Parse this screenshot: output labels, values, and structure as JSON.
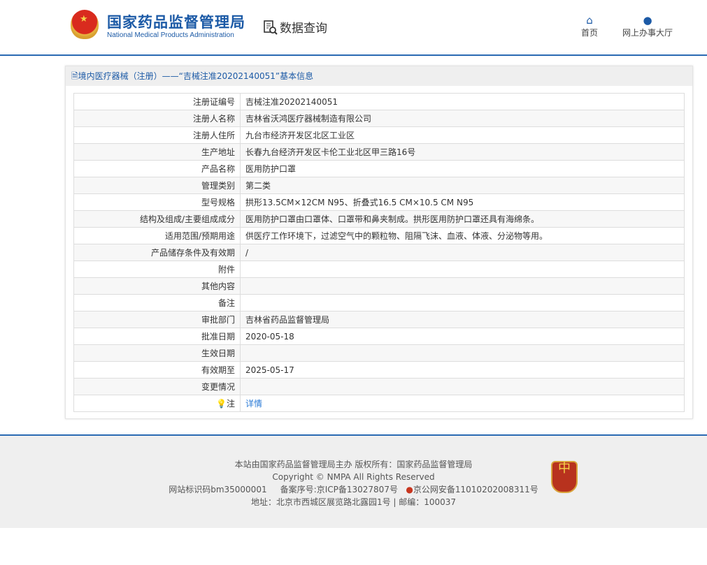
{
  "header": {
    "logo_cn": "国家药品监督管理局",
    "logo_en": "National Medical Products Administration",
    "query_label": "数据查询",
    "nav": [
      {
        "label": "首页",
        "icon": "home-icon"
      },
      {
        "label": "网上办事大厅",
        "icon": "user-icon"
      }
    ]
  },
  "panel": {
    "title": "境内医疗器械（注册）——“吉械注准20202140051”基本信息",
    "rows": [
      {
        "label": "注册证编号",
        "value": "吉械注准20202140051"
      },
      {
        "label": "注册人名称",
        "value": "吉林省沃鸿医疗器械制造有限公司"
      },
      {
        "label": "注册人住所",
        "value": "九台市经济开发区北区工业区"
      },
      {
        "label": "生产地址",
        "value": "长春九台经济开发区卡伦工业北区甲三路16号"
      },
      {
        "label": "产品名称",
        "value": "医用防护口罩"
      },
      {
        "label": "管理类别",
        "value": "第二类"
      },
      {
        "label": "型号规格",
        "value": "拱形13.5CM×12CM N95、折叠式16.5 CM×10.5 CM N95"
      },
      {
        "label": "结构及组成/主要组成成分",
        "value": "医用防护口罩由口罩体、口罩带和鼻夹制成。拱形医用防护口罩还具有海绵条。"
      },
      {
        "label": "适用范围/预期用途",
        "value": "供医疗工作环境下，过滤空气中的颗粒物、阻隔飞沫、血液、体液、分泌物等用。"
      },
      {
        "label": "产品储存条件及有效期",
        "value": "/"
      },
      {
        "label": "附件",
        "value": ""
      },
      {
        "label": "其他内容",
        "value": ""
      },
      {
        "label": "备注",
        "value": ""
      },
      {
        "label": "审批部门",
        "value": "吉林省药品监督管理局"
      },
      {
        "label": "批准日期",
        "value": "2020-05-18"
      },
      {
        "label": "生效日期",
        "value": ""
      },
      {
        "label": "有效期至",
        "value": "2025-05-17"
      },
      {
        "label": "变更情况",
        "value": ""
      }
    ],
    "note_label": "注",
    "note_link": "详情"
  },
  "footer": {
    "line1": "本站由国家药品监督管理局主办 版权所有：国家药品监督管理局",
    "line2": "Copyright © NMPA All Rights Reserved",
    "site_id": "网站标识码bm35000001",
    "icp": "备案序号:京ICP备13027807号",
    "police": "京公网安备11010202008311号",
    "address": "地址：北京市西城区展览路北露园1号 | 邮编：100037"
  }
}
